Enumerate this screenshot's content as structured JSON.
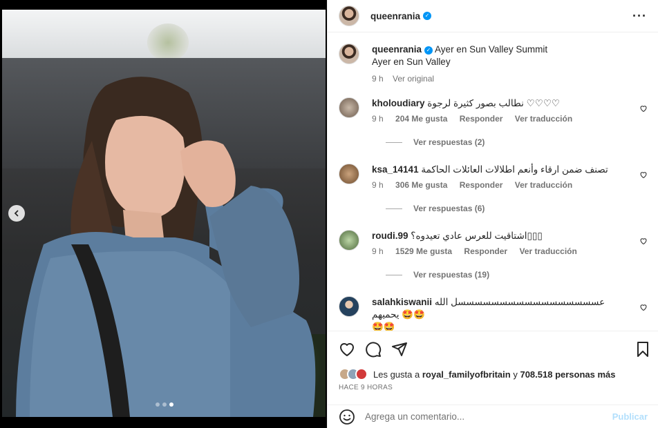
{
  "post": {
    "author": "queenrania",
    "more_icon": "more-horizontal-icon"
  },
  "caption": {
    "author": "queenrania",
    "text": "Ayer en Sun Valley Summit",
    "text2": "Ayer en Sun Valley",
    "time": "9 h",
    "see_original": "Ver original"
  },
  "comments": [
    {
      "user": "kholoudiary",
      "text": "نطالب بصور كثيرة لرجوة ♡♡♡♡",
      "time": "9 h",
      "likes": "204 Me gusta",
      "reply": "Responder",
      "translate": "Ver traducción",
      "replies": "Ver respuestas (2)"
    },
    {
      "user": "ksa_14141",
      "text": "تصنف ضمن ارقاء وأنعم اطلالات العائلات الحاكمة",
      "time": "9 h",
      "likes": "306 Me gusta",
      "reply": "Responder",
      "translate": "Ver traducción",
      "replies": "Ver respuestas (6)"
    },
    {
      "user": "roudi.99",
      "text": "اشتاقيت للعرس عادي تعيدوه؟▯▯▯",
      "time": "9 h",
      "likes": "1529 Me gusta",
      "reply": "Responder",
      "translate": "Ver traducción",
      "replies": "Ver respuestas (19)"
    },
    {
      "user": "salahkiswanii",
      "text": "عسسسسسسسسسسسسسسسسسل الله يحميهم 🤩🤩",
      "text2": "🤩🤩"
    }
  ],
  "likes_line": {
    "prefix": "Les gusta a",
    "user": "royal_familyofbritain",
    "mid": "y",
    "rest": "708.518 personas más"
  },
  "timestamp": "HACE 9 HORAS",
  "composer": {
    "placeholder": "Agrega un comentario...",
    "publish": "Publicar"
  },
  "carousel": {
    "slides": 3,
    "active": 3
  },
  "colors": {
    "verified": "#0095f6",
    "publish": "#b2dffc",
    "meta": "#737373"
  }
}
